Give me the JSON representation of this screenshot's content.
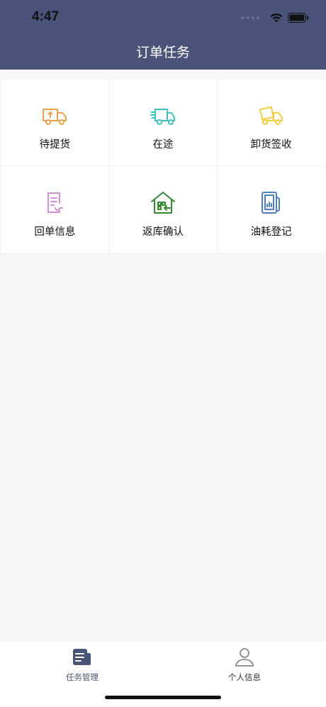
{
  "status_bar": {
    "time": "4:47"
  },
  "header": {
    "title": "订单任务"
  },
  "grid": {
    "items": [
      {
        "label": "待提货",
        "icon": "truck-loading-icon",
        "color": "#f1a04a"
      },
      {
        "label": "在途",
        "icon": "truck-moving-icon",
        "color": "#3cc3c5"
      },
      {
        "label": "卸货签收",
        "icon": "truck-unload-icon",
        "color": "#f4cc3c"
      },
      {
        "label": "回单信息",
        "icon": "receipt-document-icon",
        "color": "#d78ad8"
      },
      {
        "label": "返库确认",
        "icon": "warehouse-return-icon",
        "color": "#2e8b2e"
      },
      {
        "label": "油耗登记",
        "icon": "fuel-pump-icon",
        "color": "#4a7fc1"
      }
    ]
  },
  "tabbar": {
    "tabs": [
      {
        "label": "任务管理",
        "icon": "task-list-icon",
        "active": true,
        "color": "#4a5479"
      },
      {
        "label": "个人信息",
        "icon": "person-icon",
        "active": false,
        "color": "#333333"
      }
    ]
  }
}
